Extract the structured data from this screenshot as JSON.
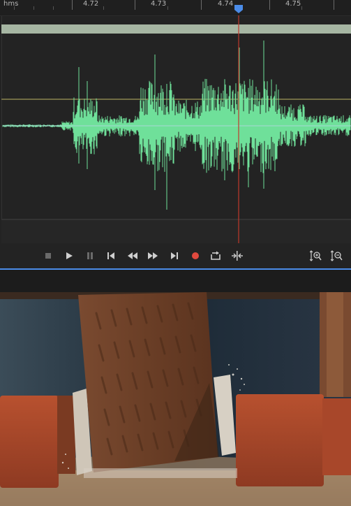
{
  "ruler": {
    "unit": "hms",
    "ticks": [
      "4.72",
      "4.73",
      "4.74",
      "4.75"
    ]
  },
  "colors": {
    "waveform": "#6fe09a",
    "overview": "#a6b6a3",
    "playhead": "#c0392b",
    "playhead_marker": "#4b8ce8",
    "record": "#e0493e",
    "accent_line": "#4b8ce8"
  },
  "transport": {
    "buttons": [
      {
        "name": "stop-button",
        "icon": "stop-icon"
      },
      {
        "name": "play-button",
        "icon": "play-icon"
      },
      {
        "name": "pause-button",
        "icon": "pause-icon"
      },
      {
        "name": "skip-to-start-button",
        "icon": "skip-back-icon"
      },
      {
        "name": "rewind-button",
        "icon": "rewind-icon"
      },
      {
        "name": "fast-forward-button",
        "icon": "fast-forward-icon"
      },
      {
        "name": "skip-to-end-button",
        "icon": "skip-forward-icon"
      },
      {
        "name": "record-button",
        "icon": "record-icon"
      },
      {
        "name": "loop-button",
        "icon": "loop-icon"
      },
      {
        "name": "skip-selection-button",
        "icon": "skip-selection-icon"
      },
      {
        "name": "zoom-in-amplitude-button",
        "icon": "zoom-in-icon"
      },
      {
        "name": "zoom-out-amplitude-button",
        "icon": "zoom-out-icon"
      }
    ]
  },
  "video": {
    "description_icon": "video-frame"
  }
}
